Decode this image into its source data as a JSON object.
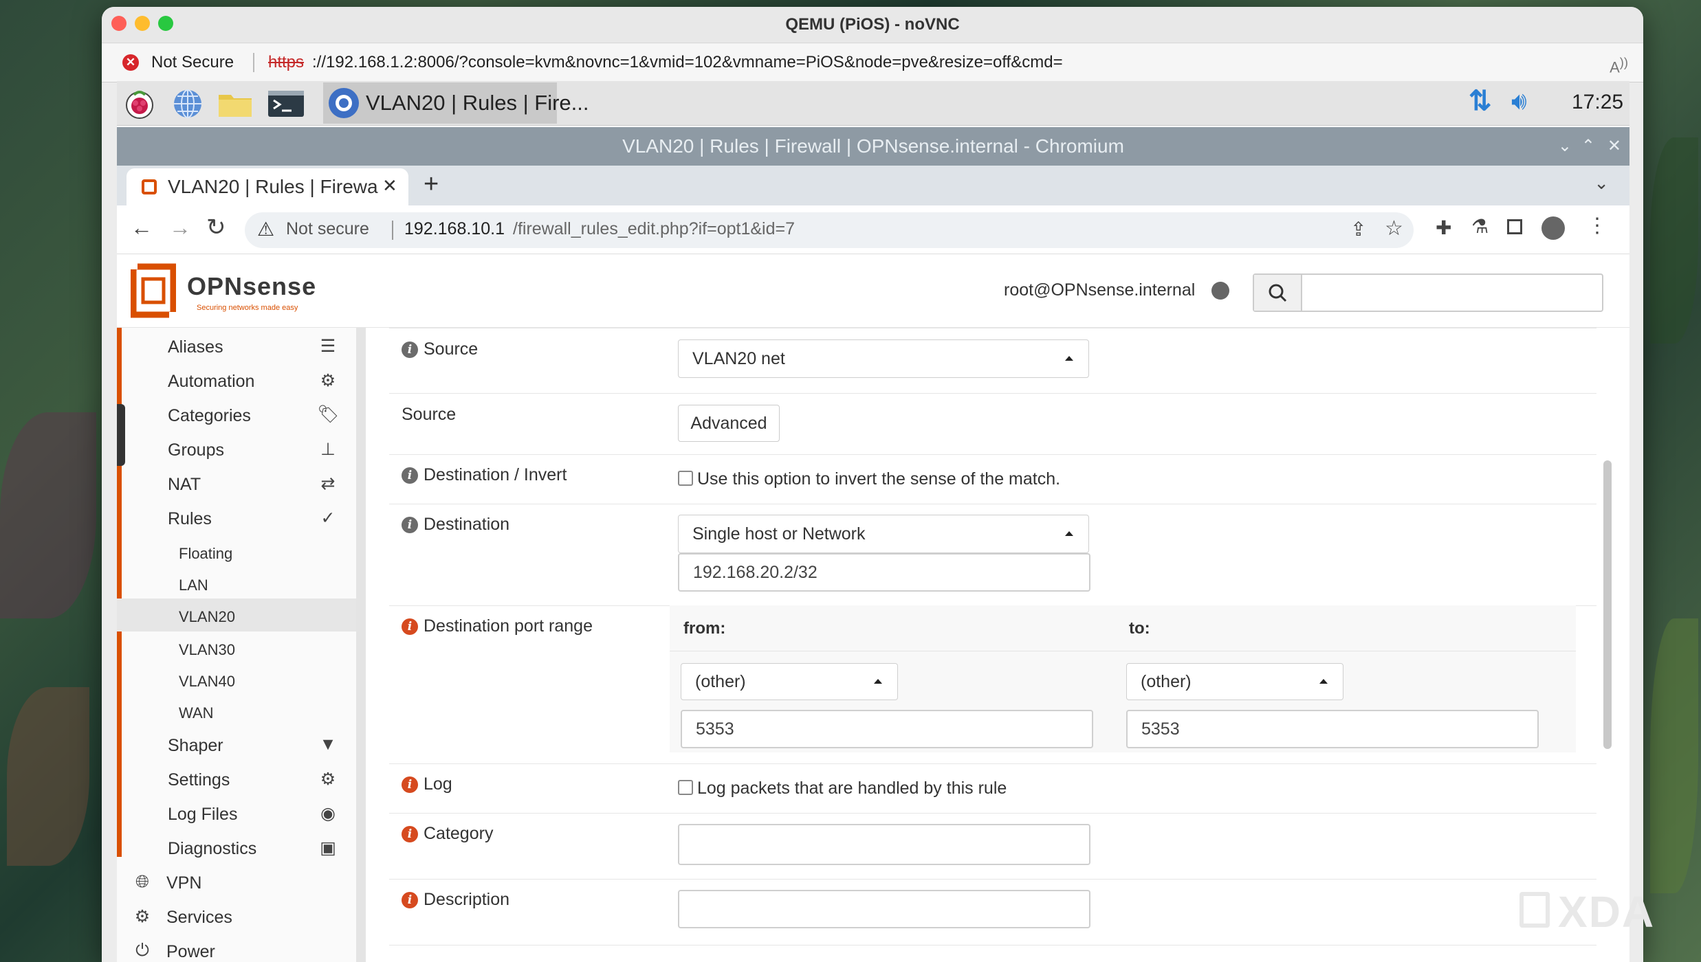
{
  "mac": {
    "title": "QEMU (PiOS) - noVNC",
    "security": "Not Secure",
    "url_scheme": "https",
    "url_rest": "://192.168.1.2:8006/?console=kvm&novnc=1&vmid=102&vmname=PiOS&node=pve&resize=off&cmd="
  },
  "taskbar": {
    "task_label": "VLAN20 | Rules | Fire...",
    "clock": "17:25"
  },
  "chromium": {
    "window_title": "VLAN20 | Rules | Firewall | OPNsense.internal - Chromium",
    "tab_title": "VLAN20 | Rules | Firewa",
    "not_secure": "Not secure",
    "url_host": "192.168.10.1",
    "url_path": "/firewall_rules_edit.php?if=opt1&id=7"
  },
  "header": {
    "logo_text": "OPNsense",
    "logo_tagline": "Securing networks made easy",
    "user": "root@OPNsense.internal",
    "search_placeholder": ""
  },
  "sidebar": {
    "items": [
      {
        "label": "Aliases",
        "icon": "list-icon"
      },
      {
        "label": "Automation",
        "icon": "gear-icon"
      },
      {
        "label": "Categories",
        "icon": "tags-icon"
      },
      {
        "label": "Groups",
        "icon": "sitemap-icon"
      },
      {
        "label": "NAT",
        "icon": "exchange-icon"
      },
      {
        "label": "Rules",
        "icon": "check-icon"
      }
    ],
    "subitems": [
      "Floating",
      "LAN",
      "VLAN20",
      "VLAN30",
      "VLAN40",
      "WAN"
    ],
    "items2": [
      {
        "label": "Shaper",
        "icon": "filter-icon"
      },
      {
        "label": "Settings",
        "icon": "gears-icon"
      },
      {
        "label": "Log Files",
        "icon": "eye-icon"
      },
      {
        "label": "Diagnostics",
        "icon": "medkit-icon"
      }
    ],
    "top_items": [
      {
        "label": "VPN",
        "icon": "globe-icon"
      },
      {
        "label": "Services",
        "icon": "cog-icon"
      },
      {
        "label": "Power",
        "icon": "plug-icon"
      }
    ],
    "active_sub": "VLAN20"
  },
  "form": {
    "source_label": "Source",
    "source_value": "VLAN20 net",
    "source_adv_label": "Source",
    "advanced_button": "Advanced",
    "dest_invert_label": "Destination / Invert",
    "dest_invert_text": "Use this option to invert the sense of the match.",
    "destination_label": "Destination",
    "destination_type": "Single host or Network",
    "destination_value": "192.168.20.2/32",
    "port_range_label": "Destination port range",
    "from_label": "from:",
    "to_label": "to:",
    "from_select": "(other)",
    "to_select": "(other)",
    "from_port": "5353",
    "to_port": "5353",
    "log_label": "Log",
    "log_text": "Log packets that are handled by this rule",
    "category_label": "Category",
    "category_value": "",
    "description_label": "Description",
    "description_value": ""
  },
  "watermark": "XDA"
}
